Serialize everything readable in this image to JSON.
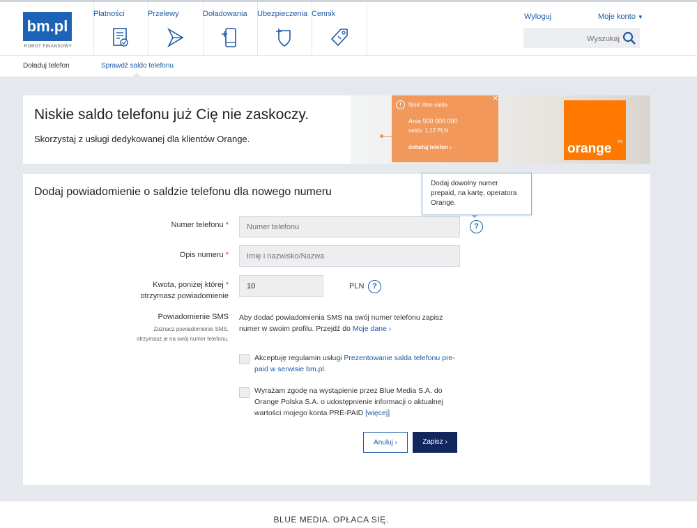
{
  "header": {
    "logo_text": "bm.pl",
    "logo_subtitle": "ROBOT FINANSOWY",
    "nav": [
      {
        "label": "Płatności",
        "icon": "payments-icon"
      },
      {
        "label": "Przelewy",
        "icon": "transfers-icon"
      },
      {
        "label": "Doładowania",
        "icon": "phone-topup-icon"
      },
      {
        "label": "Ubezpieczenia",
        "icon": "insurance-shield-icon"
      },
      {
        "label": "Cennik",
        "icon": "price-tag-icon"
      }
    ],
    "logout": "Wyloguj",
    "account": "Moje konto",
    "search_placeholder": "Wyszukaj"
  },
  "subnav": {
    "item1": "Doładuj telefon",
    "item2": "Sprawdź saldo telefonu"
  },
  "banner": {
    "title": "Niskie saldo telefonu już Cię nie zaskoczy.",
    "subtitle": "Skorzystaj z usługi dedykowanej dla klientów Orange.",
    "card_title": "Niski stan salda",
    "card_line1": "Ania 500 000 000",
    "card_line2": "saldo: 1,12 PLN",
    "card_link": "doładuj telefon ›",
    "brand": "orange",
    "brand_tm": "TM"
  },
  "form": {
    "title": "Dodaj powiadomienie o saldzie telefonu dla nowego numeru",
    "phone_label": "Numer telefonu",
    "phone_placeholder": "Numer telefonu",
    "desc_label": "Opis numeru",
    "desc_placeholder": "Imię i nazwisko/Nazwa",
    "amount_label_1": "Kwota, poniżej której",
    "amount_label_2": "otrzymasz powiadomienie",
    "amount_value": "10",
    "currency": "PLN",
    "sms_label": "Powiadomienie SMS",
    "sms_hint_1": "Zaznacz powiadomienie SMS,",
    "sms_hint_2": "otrzymasz je na swój numer telefonu.",
    "sms_text": "Aby dodać powiadomienia SMS na swój numer telefonu zapisz numer w swoim profilu. Przejdź do",
    "sms_link": "Moje dane ›",
    "terms_text": "Akceptuję regulamin usługi",
    "terms_link": "Prezentowanie salda telefonu pre-paid w serwisie bm.pl.",
    "consent_text": "Wyrażam zgodę na wystąpienie przez Blue Media S.A. do Orange Polska S.A. o udostępnienie informacji o aktualnej wartości mojego konta PRE-PAID",
    "consent_link": "[więcej]",
    "cancel": "Anuluj ›",
    "save": "Zapisz ›",
    "help_symbol": "?"
  },
  "tooltip": {
    "text": "Dodaj dowolny numer prepaid, na kartę, operatora Orange."
  },
  "footer": {
    "text": "BLUE MEDIA. OPŁACA SIĘ."
  },
  "colors": {
    "primary": "#1c5aa6",
    "dark_button": "#13275f",
    "brand_orange": "#ff7900",
    "page_bg": "#e5e9ed"
  }
}
